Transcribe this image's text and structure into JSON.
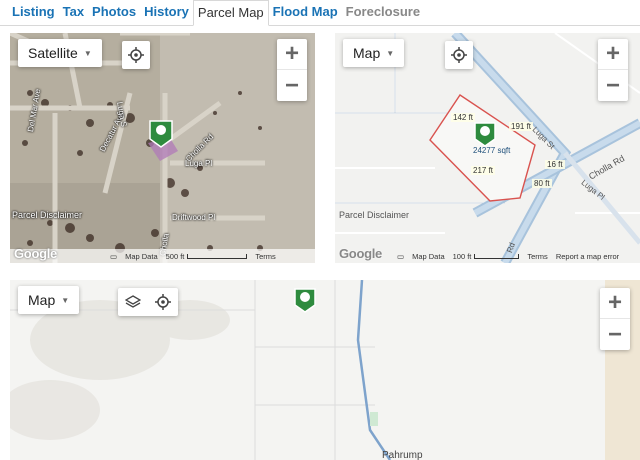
{
  "tabs": [
    "Listing",
    "Tax",
    "Photos",
    "History",
    "Parcel Map",
    "Flood Map",
    "Foreclosure"
  ],
  "active_tab": "Parcel Map",
  "map_satellite": {
    "type_label": "Satellite",
    "streets": [
      "Del Mar Ave",
      "Decatur Ave",
      "Cholla Rd",
      "Luga Pl",
      "Driftwood Pl",
      "Cholla",
      "Luga S"
    ],
    "disclaimer": "Parcel Disclaimer",
    "google": "Google",
    "map_data": "Map Data",
    "scale": "500 ft",
    "terms": "Terms"
  },
  "map_parcel": {
    "type_label": "Map",
    "dims": [
      "142 ft",
      "191 ft",
      "16 ft",
      "217 ft",
      "80 ft"
    ],
    "area": "24277 sqft",
    "streets": [
      "Luga St",
      "Cholla Rd",
      "Luga Pl",
      "Rd"
    ],
    "disclaimer": "Parcel Disclaimer",
    "google": "Google",
    "map_data": "Map Data",
    "scale": "100 ft",
    "terms": "Terms",
    "report": "Report a map error"
  },
  "map_area": {
    "type_label": "Map",
    "town": "Pahrump"
  },
  "colors": {
    "tab_link": "#1a73b5",
    "pin_green": "#2e8b3e",
    "parcel_outline": "#d9534f",
    "parcel_fill_sat": "#b07ab8",
    "road": "#8fb4d6"
  }
}
